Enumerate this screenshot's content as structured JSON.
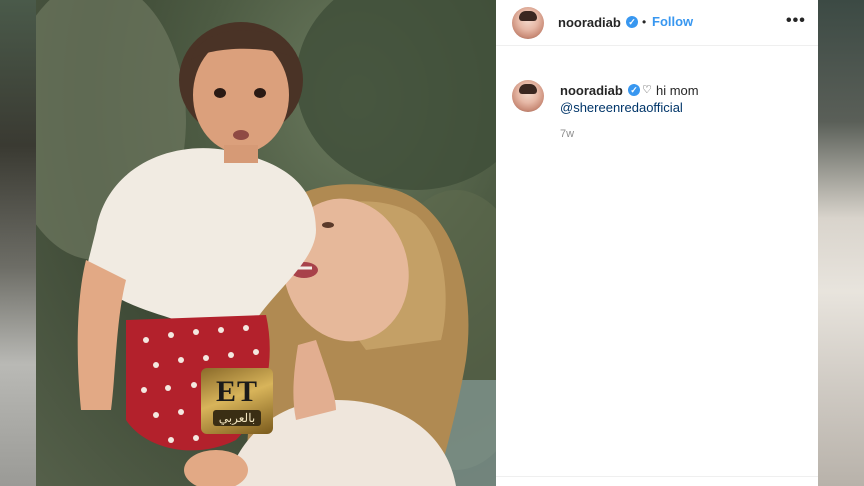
{
  "post": {
    "username": "nooradiab",
    "follow_label": "Follow",
    "more_label": "•••",
    "caption_heart": "♡",
    "caption_text": "hi mom",
    "mention": "@shereenredaofficial",
    "time_ago": "7w"
  },
  "watermark": {
    "logo_text": "ET",
    "logo_subtext": "بالعربي"
  },
  "colors": {
    "link_blue": "#3897f0",
    "verified_blue": "#3897f0",
    "mention_navy": "#003569",
    "meta_grey": "#8e8e8e"
  },
  "icons": [
    "verified-badge-icon",
    "heart-icon",
    "more-options-icon"
  ]
}
